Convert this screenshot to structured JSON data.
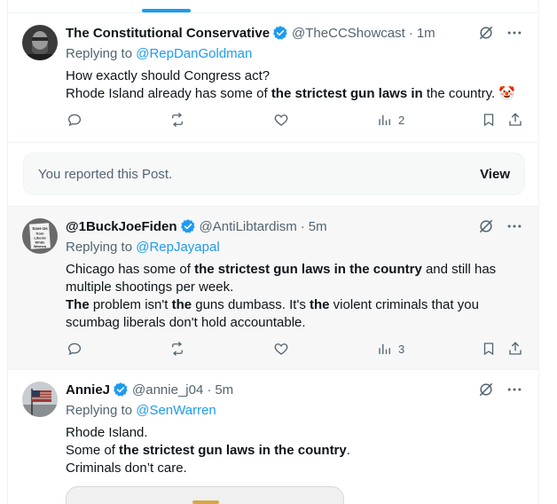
{
  "posts": [
    {
      "name": "The Constitutional Conservative",
      "handle": "@TheCCShowcast",
      "time": "1m",
      "replying_label": "Replying to",
      "replying_to": "@RepDanGoldman",
      "line1": "How exactly should Congress act?",
      "line2_pre": "Rhode Island already has some of ",
      "line2_bold": "the strictest gun laws in",
      "line2_post": " the country. 🤡",
      "views": "2"
    },
    {
      "name": "@1BuckJoeFiden",
      "handle": "@AntiLibtardism",
      "time": "5m",
      "replying_label": "Replying to",
      "replying_to": "@RepJayapal",
      "p1_pre": "Chicago has some of ",
      "p1_bold": "the strictest gun laws in the country",
      "p1_post": " and still has multiple shootings per week.",
      "p2_b1": "The",
      "p2_t1": " problem isn't ",
      "p2_b2": "the",
      "p2_t2": " guns dumbass. It's ",
      "p2_b3": "the",
      "p2_t3": " violent criminals that you scumbag liberals don't hold accountable.",
      "avatar_sign": "Save Us from Liberal White Women",
      "views": "3"
    },
    {
      "name": "AnnieJ",
      "handle": "@annie_j04",
      "time": "5m",
      "replying_label": "Replying to",
      "replying_to": "@SenWarren",
      "line1": "Rhode Island.",
      "line2_pre": "Some of ",
      "line2_bold": "the strictest gun laws in the country",
      "line2_post": ".",
      "line3": "Criminals don’t care."
    }
  ],
  "reported": {
    "text": "You reported this Post.",
    "button": "View"
  },
  "colors": {
    "accent": "#1d9bf0",
    "muted": "#536471",
    "text": "#0f1419"
  },
  "icons": [
    "verified-badge-icon",
    "grok-icon",
    "more-icon",
    "reply-icon",
    "repost-icon",
    "like-icon",
    "views-icon",
    "bookmark-icon",
    "share-icon"
  ]
}
